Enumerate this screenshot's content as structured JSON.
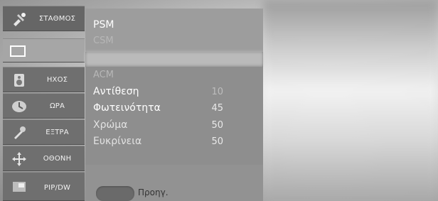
{
  "sidebar": {
    "items": [
      {
        "label": "ΣΤΑΘΜΟΣ",
        "icon": "satellite-icon"
      },
      {
        "label": "",
        "icon": "screen-icon"
      },
      {
        "label": "ΗΧΟΣ",
        "icon": "speaker-icon"
      },
      {
        "label": "ΩΡΑ",
        "icon": "clock-icon"
      },
      {
        "label": "ΕΞΤΡΑ",
        "icon": "wrench-icon"
      },
      {
        "label": "ΟΘΟΝΗ",
        "icon": "move-arrows-icon"
      },
      {
        "label": "PIP/DW",
        "icon": "pip-icon"
      }
    ]
  },
  "panel": {
    "psm": "PSM",
    "csm": "CSM",
    "acm": "ACM",
    "settings": [
      {
        "label": "Αντίθεση",
        "value": "10"
      },
      {
        "label": "Φωτεινότητα",
        "value": "45"
      },
      {
        "label": "Χρώμα",
        "value": "50"
      },
      {
        "label": "Ευκρίνεια",
        "value": "50"
      }
    ]
  },
  "footer": {
    "prev_label": "Προηγ."
  }
}
